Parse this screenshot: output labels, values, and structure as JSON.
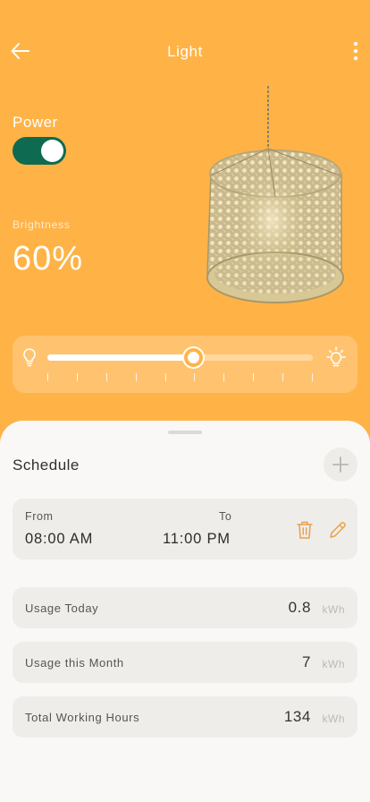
{
  "header": {
    "title": "Light"
  },
  "power": {
    "label": "Power",
    "on": true
  },
  "brightness": {
    "label": "Brightness",
    "value_text": "60%",
    "level": 0.55
  },
  "colors": {
    "accent": "#FFB347",
    "toggle_on": "#0E6B52",
    "sheet": "#F9F8F6",
    "card": "#EFEDEA"
  },
  "icons": {
    "back": "arrow-left-icon",
    "more": "more-vertical-icon",
    "bulb_low": "bulb-icon",
    "bulb_high": "bulb-bright-icon",
    "add": "plus-icon",
    "delete": "trash-icon",
    "edit": "pencil-icon",
    "lamp": "pendant-lamp-image"
  },
  "schedule": {
    "title": "Schedule",
    "from_label": "From",
    "from_time": "08:00 AM",
    "to_label": "To",
    "to_time": "11:00 PM"
  },
  "stats": [
    {
      "label": "Usage Today",
      "value": "0.8",
      "unit": "kWh"
    },
    {
      "label": "Usage this Month",
      "value": "7",
      "unit": "kWh"
    },
    {
      "label": "Total Working Hours",
      "value": "134",
      "unit": "kWh"
    }
  ]
}
